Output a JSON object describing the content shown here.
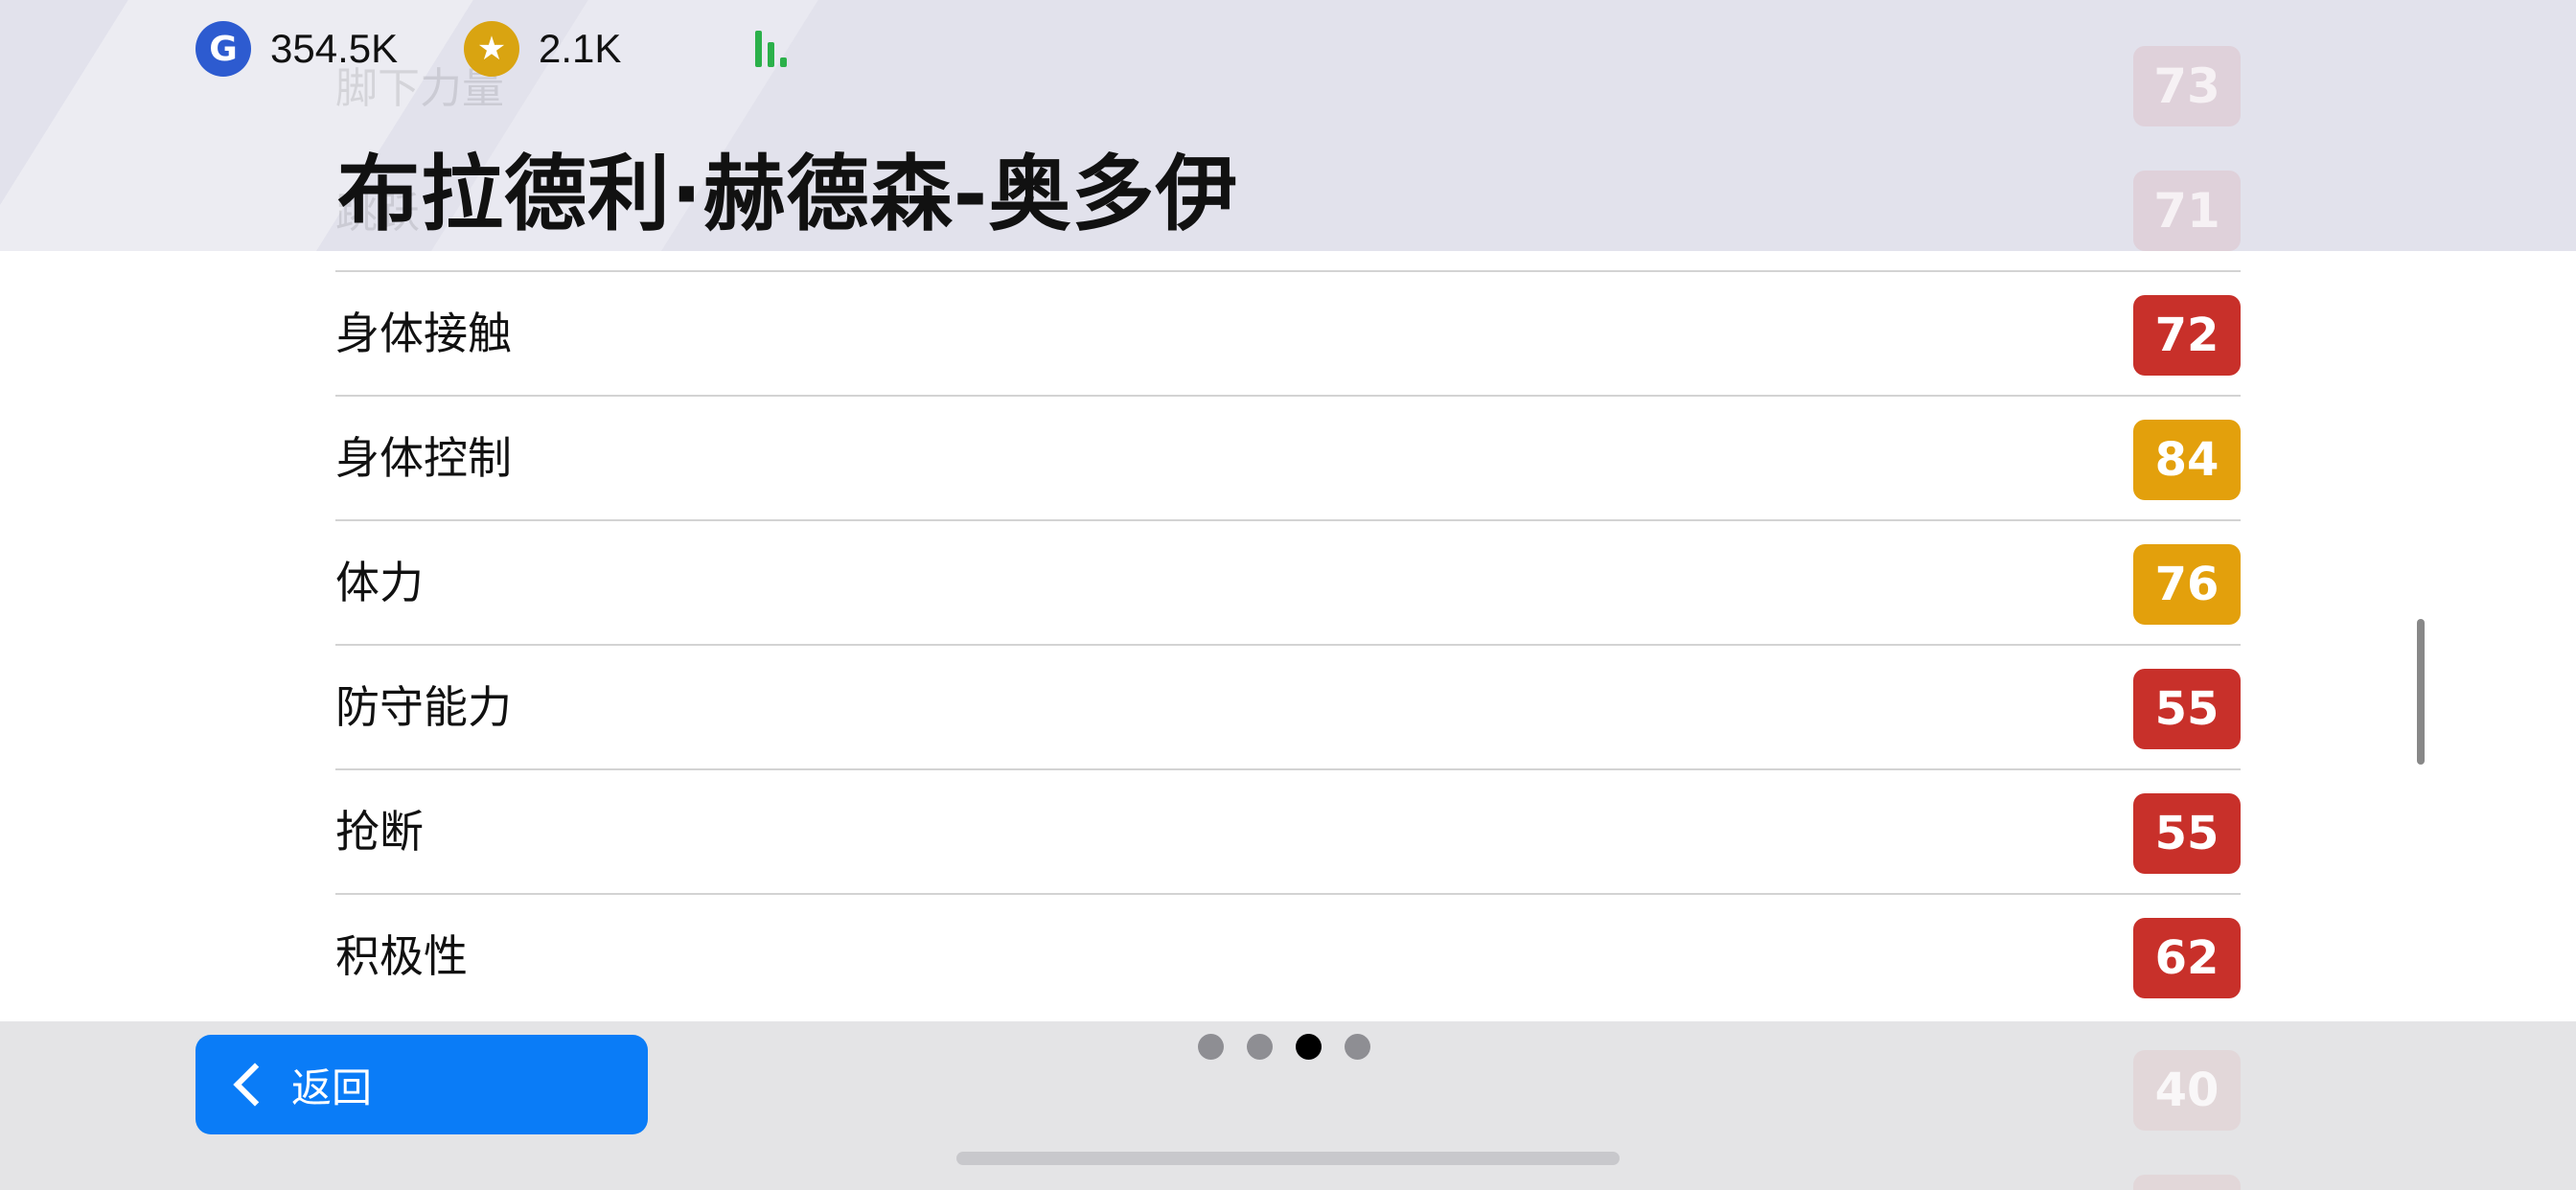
{
  "currency": {
    "gp": {
      "icon": "g-coin-icon",
      "glyph": "G",
      "value": "354.5K"
    },
    "coins": {
      "icon": "star-coin-icon",
      "glyph": "★",
      "value": "2.1K"
    }
  },
  "player": {
    "name": "布拉德利·赫德森-奥多伊"
  },
  "ghost_rows": [
    {
      "label": "脚下力量",
      "value": "73"
    },
    {
      "label": "跳跃",
      "value": "71"
    }
  ],
  "stats": [
    {
      "label": "身体接触",
      "value": "72",
      "color": "#c8302a"
    },
    {
      "label": "身体控制",
      "value": "84",
      "color": "#e3a00c"
    },
    {
      "label": "体力",
      "value": "76",
      "color": "#e3a00c"
    },
    {
      "label": "防守能力",
      "value": "55",
      "color": "#c8302a"
    },
    {
      "label": "抢断",
      "value": "55",
      "color": "#c8302a"
    },
    {
      "label": "积极性",
      "value": "62",
      "color": "#c8302a"
    }
  ],
  "ghost_bottom": {
    "value": "40"
  },
  "footer": {
    "back_label": "返回",
    "back_icon": "chevron-left-icon",
    "pages": 4,
    "active_page": 3
  },
  "colors": {
    "accent": "#0a7cf7",
    "red": "#c8302a",
    "gold": "#e3a00c",
    "signal": "#2bb04a"
  }
}
